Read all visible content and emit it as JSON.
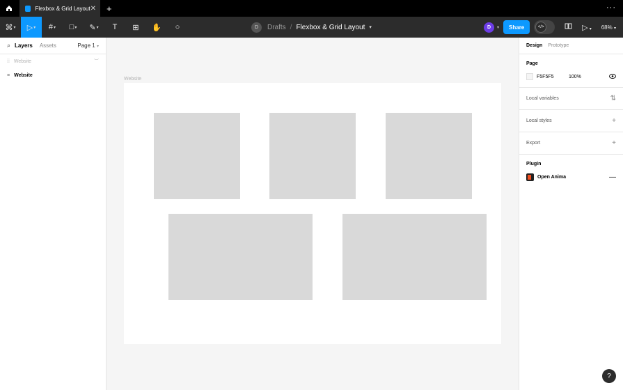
{
  "tabbar": {
    "home_icon": "home-icon",
    "tab_title": "Flexbox & Grid Layout",
    "close_glyph": "✕",
    "add_glyph": "+",
    "more_glyph": "···"
  },
  "toolbar": {
    "tools": [
      {
        "name": "main-menu",
        "glyph": "⌘",
        "active": false
      },
      {
        "name": "move",
        "glyph": "▷",
        "active": true
      },
      {
        "name": "frame",
        "glyph": "#",
        "active": false
      },
      {
        "name": "shape",
        "glyph": "□",
        "active": false
      },
      {
        "name": "pen",
        "glyph": "✎",
        "active": false
      },
      {
        "name": "text",
        "glyph": "T",
        "active": false
      },
      {
        "name": "resources",
        "glyph": "⊞",
        "active": false
      },
      {
        "name": "hand",
        "glyph": "✋",
        "active": false
      },
      {
        "name": "comment",
        "glyph": "○",
        "active": false
      }
    ],
    "breadcrumb_avatar": "D",
    "breadcrumb_folder": "Drafts",
    "breadcrumb_separator": "/",
    "breadcrumb_file": "Flexbox & Grid Layout",
    "user_avatar": "D",
    "share_label": "Share",
    "dev_mode_glyph": "</>",
    "zoom": "68%",
    "accent": "#0d99ff"
  },
  "layers_panel": {
    "tab_layers": "Layers",
    "tab_assets": "Assets",
    "page_selector": "Page 1",
    "page_row": "Website",
    "layers": [
      "Website"
    ]
  },
  "canvas": {
    "frame_label": "Website",
    "frame_background": "#ffffff",
    "box_color": "#d9d9d9"
  },
  "design_panel": {
    "tab_design": "Design",
    "tab_prototype": "Prototype",
    "page_title": "Page",
    "page_color": "F5F5F5",
    "page_opacity": "100%",
    "local_variables": "Local variables",
    "local_styles": "Local styles",
    "export": "Export",
    "plugin_title": "Plugin",
    "plugin_name": "Open Anima"
  },
  "help": {
    "glyph": "?"
  }
}
